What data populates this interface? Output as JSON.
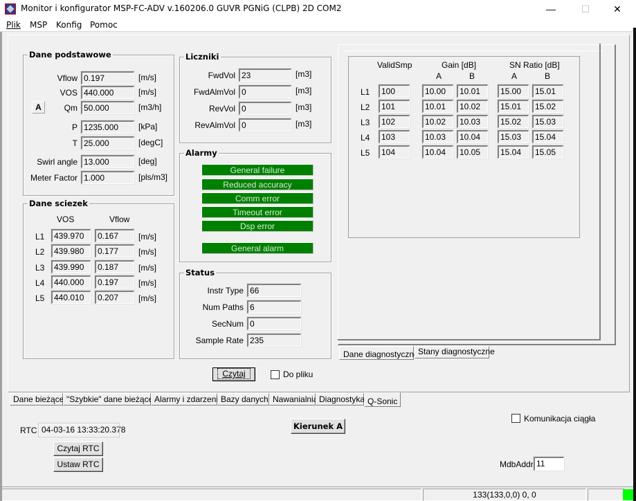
{
  "window": {
    "title": "Monitor i konfigurator MSP-FC-ADV v.160206.0 GUVR PGNiG (CLPB) 2D COM2",
    "minimize_glyph": "—",
    "maximize_glyph": "☐",
    "close_glyph": "✕"
  },
  "menu": [
    {
      "label": "Plik"
    },
    {
      "label": "MSP"
    },
    {
      "label": "Konfig"
    },
    {
      "label": "Pomoc"
    }
  ],
  "dane_podstawowe": {
    "title": "Dane podstawowe",
    "direction_badge": "A",
    "rows": [
      {
        "label": "Vflow",
        "value": "0.197",
        "unit": "[m/s]"
      },
      {
        "label": "VOS",
        "value": "440.000",
        "unit": "[m/s]"
      },
      {
        "label": "Qm",
        "value": "50.000",
        "unit": "[m3/h]"
      },
      {
        "label": "P",
        "value": "1235.000",
        "unit": "[kPa]"
      },
      {
        "label": "T",
        "value": "25.000",
        "unit": "[degC]"
      },
      {
        "label": "Swirl angle",
        "value": "13.000",
        "unit": "[deg]"
      },
      {
        "label": "Meter Factor",
        "value": "1.000",
        "unit": "[pls/m3]"
      }
    ]
  },
  "dane_sciezek": {
    "title": "Dane sciezek",
    "col_vos": "VOS",
    "col_vflow": "Vflow",
    "rows": [
      {
        "path": "L1",
        "vos": "439.970",
        "vflow": "0.167",
        "unit": "[m/s]"
      },
      {
        "path": "L2",
        "vos": "439.980",
        "vflow": "0.177",
        "unit": "[m/s]"
      },
      {
        "path": "L3",
        "vos": "439.990",
        "vflow": "0.187",
        "unit": "[m/s]"
      },
      {
        "path": "L4",
        "vos": "440.000",
        "vflow": "0.197",
        "unit": "[m/s]"
      },
      {
        "path": "L5",
        "vos": "440.010",
        "vflow": "0.207",
        "unit": "[m/s]"
      }
    ]
  },
  "liczniki": {
    "title": "Liczniki",
    "rows": [
      {
        "label": "FwdVol",
        "value": "23",
        "unit": "[m3]"
      },
      {
        "label": "FwdAlmVol",
        "value": "0",
        "unit": "[m3]"
      },
      {
        "label": "RevVol",
        "value": "0",
        "unit": "[m3]"
      },
      {
        "label": "RevAlmVol",
        "value": "0",
        "unit": "[m3]"
      }
    ]
  },
  "alarmy": {
    "title": "Alarmy",
    "color": "#008000",
    "items": [
      {
        "label": "General failure"
      },
      {
        "label": "Reduced accuracy"
      },
      {
        "label": "Comm error"
      },
      {
        "label": "Timeout error"
      },
      {
        "label": "Dsp error"
      },
      {
        "label": "General alarm"
      }
    ]
  },
  "status": {
    "title": "Status",
    "rows": [
      {
        "label": "Instr Type",
        "value": "66"
      },
      {
        "label": "Num Paths",
        "value": "6"
      },
      {
        "label": "SecNum",
        "value": "0"
      },
      {
        "label": "Sample Rate",
        "value": "235"
      }
    ]
  },
  "read_button": "Czytaj",
  "to_file_checkbox": {
    "label": "Do pliku",
    "checked": false
  },
  "diagnostics": {
    "col_validsmp": "ValidSmp",
    "col_gain": "Gain [dB]",
    "col_sn": "SN Ratio [dB]",
    "sub_a": "A",
    "sub_b": "B",
    "rows": [
      {
        "path": "L1",
        "validsmp": "100",
        "gain_a": "10.00",
        "gain_b": "10.01",
        "sn_a": "15.00",
        "sn_b": "15.01"
      },
      {
        "path": "L2",
        "validsmp": "101",
        "gain_a": "10.01",
        "gain_b": "10.02",
        "sn_a": "15.01",
        "sn_b": "15.02"
      },
      {
        "path": "L3",
        "validsmp": "102",
        "gain_a": "10.02",
        "gain_b": "10.03",
        "sn_a": "15.02",
        "sn_b": "15.03"
      },
      {
        "path": "L4",
        "validsmp": "103",
        "gain_a": "10.03",
        "gain_b": "10.04",
        "sn_a": "15.03",
        "sn_b": "15.04"
      },
      {
        "path": "L5",
        "validsmp": "104",
        "gain_a": "10.04",
        "gain_b": "10.05",
        "sn_a": "15.04",
        "sn_b": "15.05"
      }
    ],
    "tabs": [
      {
        "label": "Dane diagnostyczne",
        "active": true
      },
      {
        "label": "Stany diagnostyczne",
        "active": false
      }
    ]
  },
  "main_tabs": [
    {
      "label": "Dane bieżące",
      "active": false
    },
    {
      "label": "\"Szybkie\" dane bieżące",
      "active": false
    },
    {
      "label": "Alarmy i zdarzenia",
      "active": false
    },
    {
      "label": "Bazy danych",
      "active": false
    },
    {
      "label": "Nawanialnia",
      "active": false
    },
    {
      "label": "Diagnostyka",
      "active": false
    },
    {
      "label": "Q-Sonic",
      "active": true
    }
  ],
  "bottom": {
    "rtc_label": "RTC",
    "rtc_value": "04-03-16 13:33:20.378",
    "read_rtc_button": "Czytaj RTC",
    "set_rtc_button": "Ustaw RTC",
    "direction_button": "Kierunek A",
    "continuous_comm": {
      "label": "Komunikacja ciągła",
      "checked": false
    },
    "mdbaddr_label": "MdbAddr",
    "mdbaddr_value": "11"
  },
  "statusbar": {
    "counter_text": "133(133,0,0) 0, 0",
    "indicator_color": "#00ff00"
  }
}
